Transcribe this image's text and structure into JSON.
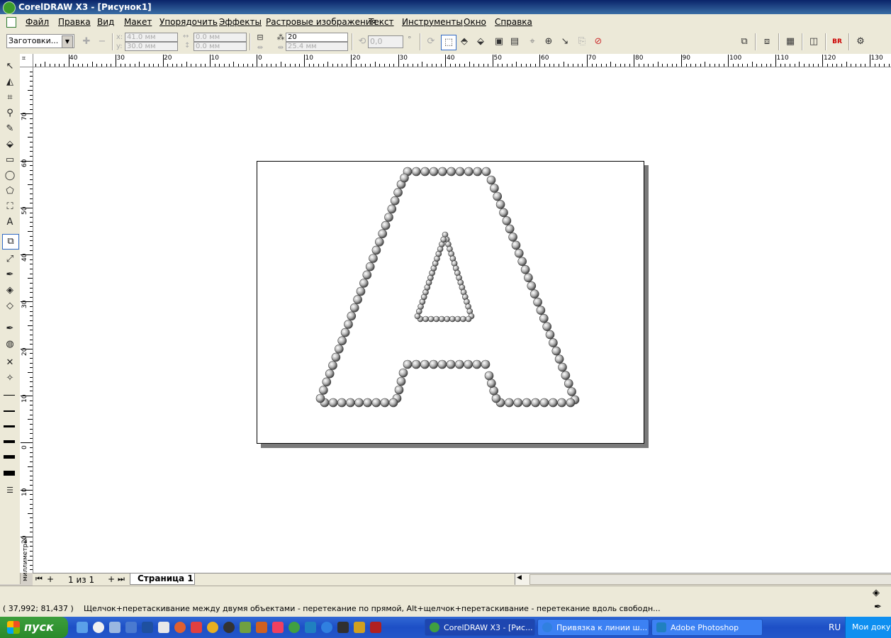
{
  "window": {
    "title": "CorelDRAW X3 - [Рисунок1]"
  },
  "menu": [
    "Файл",
    "Правка",
    "Вид",
    "Макет",
    "Упорядочить",
    "Эффекты",
    "Растровые изображения",
    "Текст",
    "Инструменты",
    "Окно",
    "Справка"
  ],
  "propbar": {
    "presets": "Заготовки...",
    "x_label": "x:",
    "x_value": "41.0 мм",
    "y_label": "y:",
    "y_value": "30.0 мм",
    "w_value": "0.0 мм",
    "h_value": "0.0 мм",
    "steps": "20",
    "spacing": "25.4 мм",
    "rotation": "0,0",
    "degree": "°"
  },
  "ruler": {
    "h_labels": [
      "40",
      "30",
      "20",
      "10",
      "0",
      "10",
      "20",
      "30",
      "40",
      "50",
      "60",
      "70",
      "80",
      "90",
      "100",
      "110",
      "120",
      "130"
    ],
    "v_labels": [
      "70",
      "60",
      "50",
      "40",
      "30",
      "20",
      "10",
      "0",
      "10",
      "20"
    ],
    "units": "миллиметры"
  },
  "pages": {
    "counter": "1 из 1",
    "tab": "Страница 1"
  },
  "status": {
    "coords": "( 37,992; 81,437 )",
    "hint": "Щелчок+перетаскивание между двумя объектами - перетекание по прямой, Alt+щелчок+перетаскивание - перетекание вдоль свободн..."
  },
  "taskbar": {
    "start": "пуск",
    "buttons": [
      "CorelDRAW X3 - [Рис...",
      "Привязка к линии ш...",
      "Adobe Photoshop"
    ],
    "lang": "RU",
    "tray_text": "Мои докум"
  },
  "colors": {
    "title": "#0a246a",
    "taskbar": "#245edb",
    "start": "#3c9e3c"
  }
}
